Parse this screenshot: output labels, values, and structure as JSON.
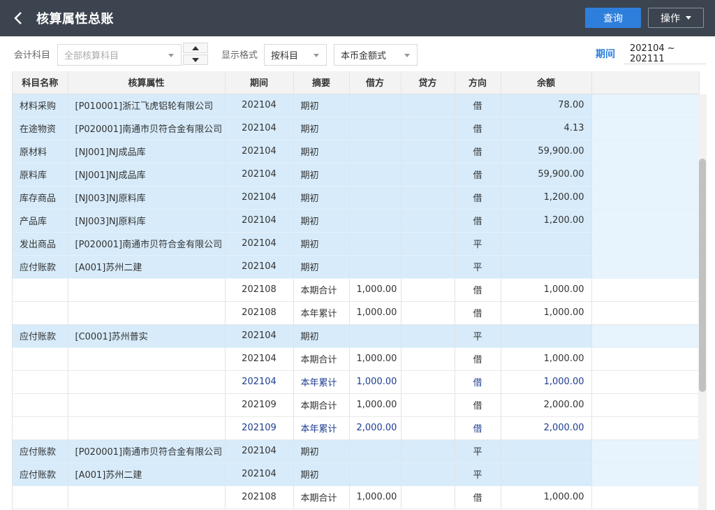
{
  "header": {
    "title": "核算属性总账",
    "query_label": "查询",
    "ops_label": "操作"
  },
  "filters": {
    "account_label": "会计科目",
    "account_placeholder": "全部核算科目",
    "display_label": "显示格式",
    "display_value": "按科目",
    "currency_value": "本币金额式",
    "period_label": "期间",
    "period_value": "202104 ~ 202111"
  },
  "table": {
    "columns": [
      "科目名称",
      "核算属性",
      "期间",
      "摘要",
      "借方",
      "贷方",
      "方向",
      "余额"
    ],
    "rows": [
      {
        "style": "hl",
        "cells": [
          "材料采购",
          "[P010001]浙江飞虎铝轮有限公司",
          "202104",
          "期初",
          "",
          "",
          "借",
          "78.00"
        ]
      },
      {
        "style": "hl",
        "cells": [
          "在途物资",
          "[P020001]南通市贝符合金有限公司",
          "202104",
          "期初",
          "",
          "",
          "借",
          "4.13"
        ]
      },
      {
        "style": "hl",
        "cells": [
          "原材料",
          "[NJ001]NJ成品库",
          "202104",
          "期初",
          "",
          "",
          "借",
          "59,900.00"
        ]
      },
      {
        "style": "hl",
        "cells": [
          "原料库",
          "[NJ001]NJ成品库",
          "202104",
          "期初",
          "",
          "",
          "借",
          "59,900.00"
        ]
      },
      {
        "style": "hl",
        "cells": [
          "库存商品",
          "[NJ003]NJ原料库",
          "202104",
          "期初",
          "",
          "",
          "借",
          "1,200.00"
        ]
      },
      {
        "style": "hl",
        "cells": [
          "产品库",
          "[NJ003]NJ原料库",
          "202104",
          "期初",
          "",
          "",
          "借",
          "1,200.00"
        ]
      },
      {
        "style": "hl",
        "cells": [
          "发出商品",
          "[P020001]南通市贝符合金有限公司",
          "202104",
          "期初",
          "",
          "",
          "平",
          ""
        ]
      },
      {
        "style": "hl",
        "cells": [
          "应付账款",
          "[A001]苏州二建",
          "202104",
          "期初",
          "",
          "",
          "平",
          ""
        ]
      },
      {
        "style": "plain",
        "cells": [
          "",
          "",
          "202108",
          "本期合计",
          "1,000.00",
          "",
          "借",
          "1,000.00"
        ]
      },
      {
        "style": "plain",
        "cells": [
          "",
          "",
          "202108",
          "本年累计",
          "1,000.00",
          "",
          "借",
          "1,000.00"
        ]
      },
      {
        "style": "hl",
        "cells": [
          "应付账款",
          "[C0001]苏州普实",
          "202104",
          "期初",
          "",
          "",
          "平",
          ""
        ]
      },
      {
        "style": "plain",
        "cells": [
          "",
          "",
          "202104",
          "本期合计",
          "1,000.00",
          "",
          "借",
          "1,000.00"
        ]
      },
      {
        "style": "blue",
        "cells": [
          "",
          "",
          "202104",
          "本年累计",
          "1,000.00",
          "",
          "借",
          "1,000.00"
        ]
      },
      {
        "style": "plain",
        "cells": [
          "",
          "",
          "202109",
          "本期合计",
          "1,000.00",
          "",
          "借",
          "2,000.00"
        ]
      },
      {
        "style": "blue",
        "cells": [
          "",
          "",
          "202109",
          "本年累计",
          "2,000.00",
          "",
          "借",
          "2,000.00"
        ]
      },
      {
        "style": "hl",
        "cells": [
          "应付账款",
          "[P020001]南通市贝符合金有限公司",
          "202104",
          "期初",
          "",
          "",
          "平",
          ""
        ]
      },
      {
        "style": "hl",
        "cells": [
          "应付账款",
          "[A001]苏州二建",
          "202104",
          "期初",
          "",
          "",
          "平",
          ""
        ]
      },
      {
        "style": "plain",
        "cells": [
          "",
          "",
          "202108",
          "本期合计",
          "1,000.00",
          "",
          "借",
          "1,000.00"
        ]
      }
    ]
  }
}
